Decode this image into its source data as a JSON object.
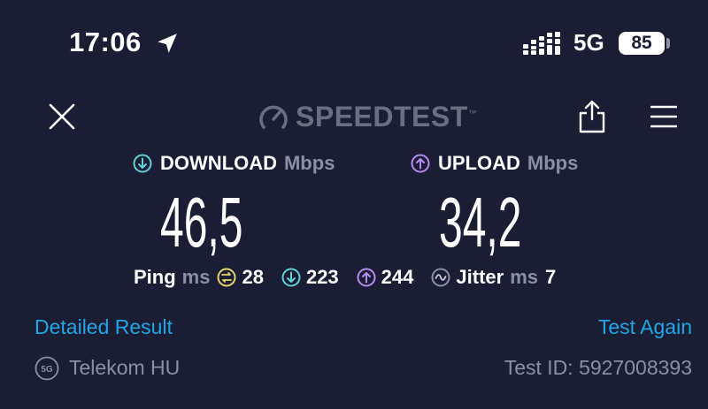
{
  "status_bar": {
    "time": "17:06",
    "network": "5G",
    "battery": "85"
  },
  "header": {
    "brand": "SPEEDTEST",
    "brand_mark": "™"
  },
  "download": {
    "label": "DOWNLOAD",
    "unit": "Mbps",
    "value": "46,5",
    "color": "#5fd3d3"
  },
  "upload": {
    "label": "UPLOAD",
    "unit": "Mbps",
    "value": "34,2",
    "color": "#b78cf2"
  },
  "ping": {
    "label": "Ping",
    "unit": "ms",
    "idle": "28",
    "download": "223",
    "upload": "244",
    "idle_color": "#e6d56a"
  },
  "jitter": {
    "label": "Jitter",
    "unit": "ms",
    "value": "7"
  },
  "actions": {
    "detailed_result": "Detailed Result",
    "test_again": "Test Again"
  },
  "footer": {
    "provider_badge": "5G",
    "provider": "Telekom HU",
    "test_id": "Test ID: 5927008393"
  },
  "icons": [
    "location-arrow-icon",
    "signal-bars-icon",
    "battery-icon",
    "close-icon",
    "speedometer-icon",
    "share-icon",
    "menu-icon",
    "download-arrow-icon",
    "upload-arrow-icon",
    "ping-idle-icon",
    "jitter-icon",
    "network-badge-icon"
  ]
}
